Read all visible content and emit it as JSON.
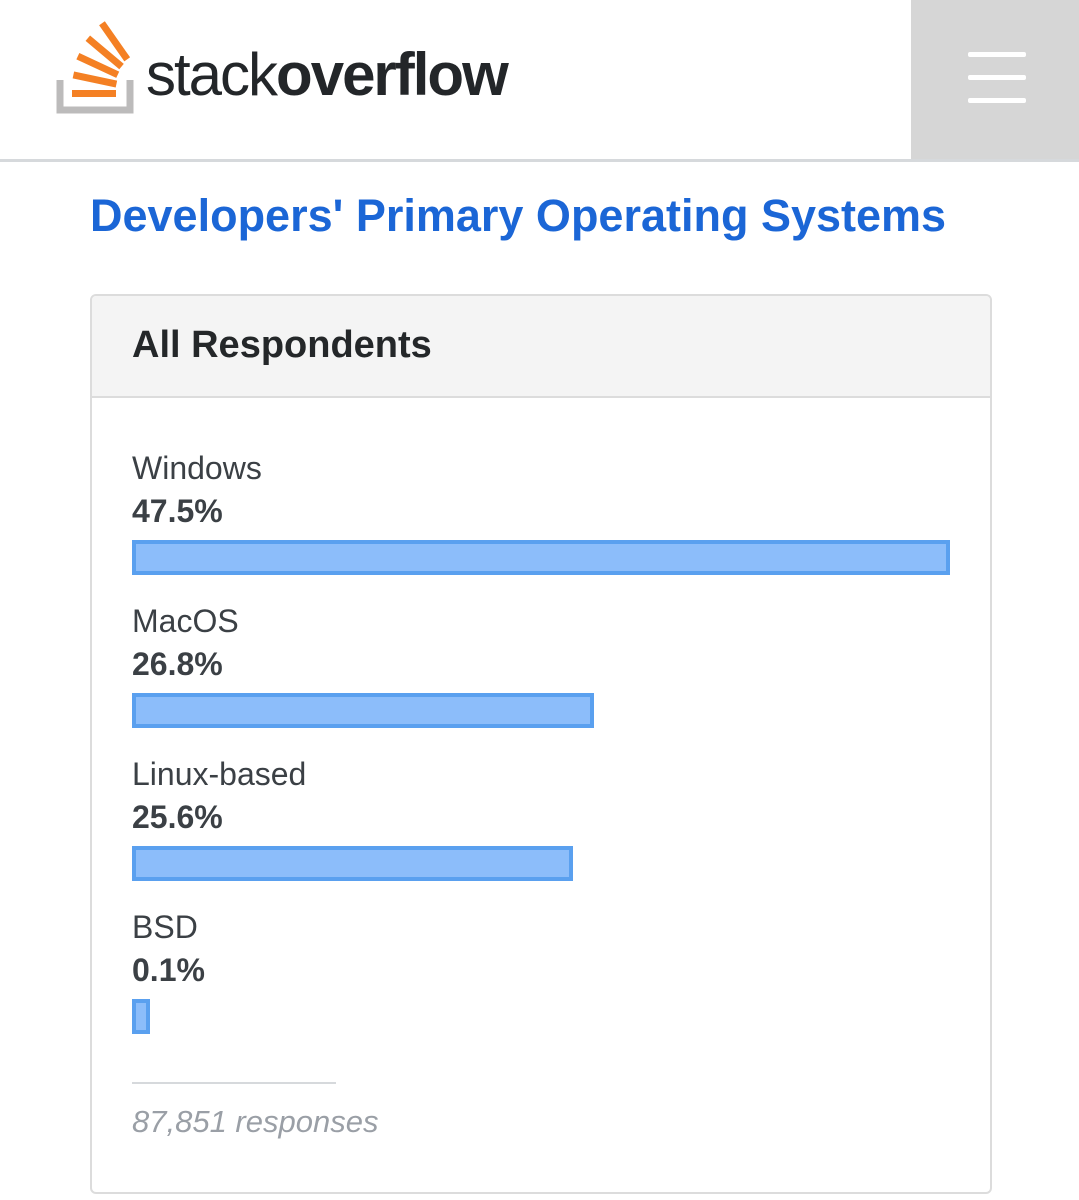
{
  "header": {
    "logo_text_light": "stack",
    "logo_text_bold": "overflow",
    "logo_icon": "stack-overflow-logo-icon",
    "menu_icon": "hamburger-menu-icon"
  },
  "page": {
    "title": "Developers' Primary Operating Systems"
  },
  "card": {
    "header": "All Respondents",
    "responses": "87,851 responses"
  },
  "colors": {
    "brand_orange": "#f48024",
    "title_blue": "#1b66d6",
    "bar_fill": "#8cbdfa",
    "bar_border": "#5aa0ef"
  },
  "chart_data": {
    "type": "bar",
    "orientation": "horizontal",
    "title": "Developers' Primary Operating Systems",
    "subtitle": "All Respondents",
    "categories": [
      "Windows",
      "MacOS",
      "Linux-based",
      "BSD"
    ],
    "values": [
      47.5,
      26.8,
      25.6,
      0.1
    ],
    "value_labels": [
      "47.5%",
      "26.8%",
      "25.6%",
      "0.1%"
    ],
    "unit": "%",
    "footnote": "87,851 responses",
    "grid": false,
    "legend": "none"
  }
}
